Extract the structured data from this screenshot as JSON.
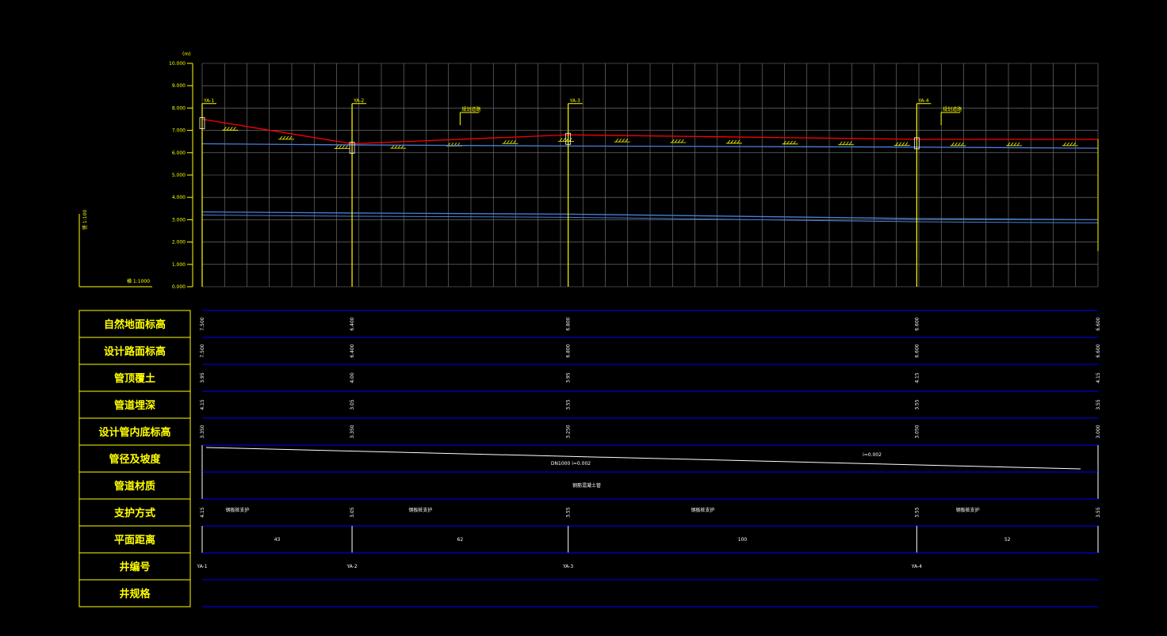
{
  "colors": {
    "background": "#000000",
    "grid": "#7f7f7f",
    "accent_yellow": "#ffff00",
    "ground_red": "#ff0000",
    "pipe_blue": "#4a7fd6",
    "table_blue": "#0000ff",
    "text_white": "#ffffff"
  },
  "chart_data": {
    "type": "line",
    "y_unit": "(m)",
    "ylim": [
      0,
      10
    ],
    "yticks": [
      "0.000",
      "1.000",
      "2.000",
      "3.000",
      "4.000",
      "5.000",
      "6.000",
      "7.000",
      "8.000",
      "9.000",
      "10.000"
    ],
    "x": [
      0,
      43,
      105,
      205,
      257
    ],
    "series": [
      {
        "values": [
          7.5,
          6.4,
          6.8,
          6.6,
          6.6
        ]
      },
      {
        "values": [
          6.4,
          6.35,
          6.3,
          6.25,
          6.2
        ]
      },
      {
        "values": [
          3.35,
          3.3,
          3.25,
          3.05,
          3.0
        ]
      }
    ],
    "wells": [
      {
        "label": "YA-1",
        "x": 0,
        "top": 8.2
      },
      {
        "label": "YA-2",
        "x": 43,
        "top": 8.2
      },
      {
        "label": "YA-3",
        "x": 105,
        "top": 8.2
      },
      {
        "label": "YA-4",
        "x": 205,
        "top": 8.2
      }
    ],
    "markers": [
      {
        "label": "规划道路",
        "x": 74,
        "y": 7.8
      },
      {
        "label": "规划道路",
        "x": 212,
        "y": 7.8
      }
    ],
    "scale_note": {
      "vertical": "竖 1:100",
      "horizontal": "横 1:1000"
    }
  },
  "table": {
    "rows": [
      {
        "label": "自然地面标高",
        "values": [
          "7.500",
          "6.400",
          "6.800",
          "6.600",
          "6.600"
        ]
      },
      {
        "label": "设计路面标高",
        "values": [
          "7.500",
          "6.400",
          "6.800",
          "6.600",
          "6.600"
        ]
      },
      {
        "label": "管顶覆土",
        "values": [
          "3.95",
          "4.00",
          "3.95",
          "4.15",
          "4.15"
        ]
      },
      {
        "label": "管道埋深",
        "values": [
          "4.15",
          "3.05",
          "3.55",
          "3.55",
          "3.55"
        ]
      },
      {
        "label": "设计管内底标高",
        "values": [
          "3.350",
          "3.350",
          "3.250",
          "3.050",
          "3.000"
        ]
      },
      {
        "label": "管径及坡度",
        "texts": [
          "DN1000  i=0.002",
          "i=0.002"
        ]
      },
      {
        "label": "管道材质",
        "texts": [
          "钢筋混凝土管"
        ]
      },
      {
        "label": "支护方式",
        "values": [
          "4.15",
          "3.05",
          "3.55",
          "3.55",
          "3.55"
        ],
        "texts": [
          "钢板桩支护",
          "钢板桩支护",
          "钢板桩支护",
          "钢板桩支护"
        ]
      },
      {
        "label": "平面距离",
        "texts": [
          "43",
          "62",
          "100",
          "52"
        ]
      },
      {
        "label": "井编号",
        "texts": [
          "YA-1",
          "YA-2",
          "YA-3",
          "YA-4"
        ]
      },
      {
        "label": "井规格",
        "texts": []
      }
    ]
  }
}
